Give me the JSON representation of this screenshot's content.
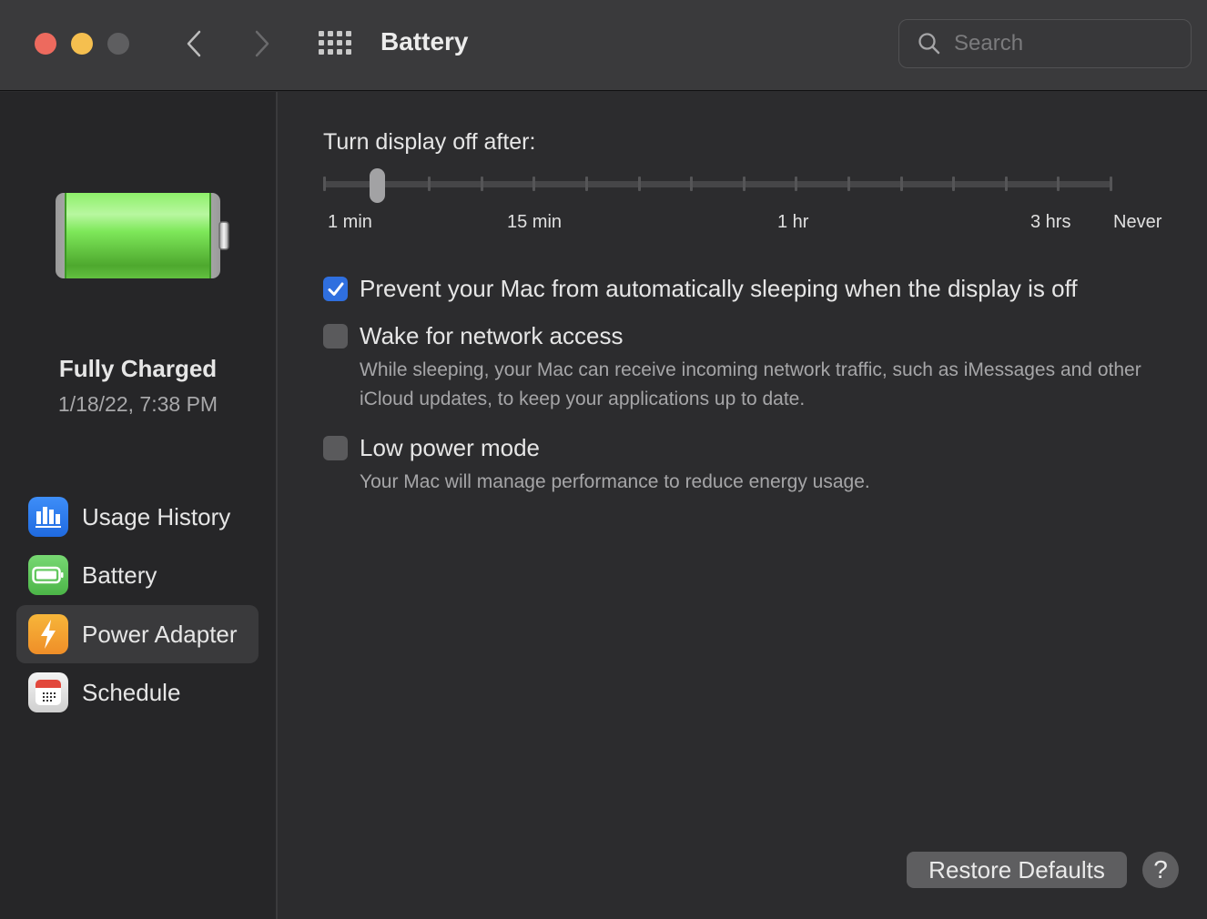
{
  "window": {
    "title": "Battery",
    "search_placeholder": "Search",
    "search_value": ""
  },
  "sidebar": {
    "status_title": "Fully Charged",
    "status_date": "1/18/22, 7:38 PM",
    "battery_level_percent": 100,
    "items": [
      {
        "label": "Usage History",
        "icon": "bar-chart-icon",
        "active": false
      },
      {
        "label": "Battery",
        "icon": "battery-icon",
        "active": false
      },
      {
        "label": "Power Adapter",
        "icon": "lightning-bolt-icon",
        "active": true
      },
      {
        "label": "Schedule",
        "icon": "calendar-icon",
        "active": false
      }
    ]
  },
  "main": {
    "slider": {
      "label": "Turn display off after:",
      "tick_count": 16,
      "selected_index": 1,
      "selected_value": "2 min",
      "tick_labels": [
        "1 min",
        "15 min",
        "1 hr",
        "3 hrs",
        "Never"
      ]
    },
    "options": [
      {
        "label": "Prevent your Mac from automatically sleeping when the display is off",
        "checked": true,
        "description": ""
      },
      {
        "label": "Wake for network access",
        "checked": false,
        "description": "While sleeping, your Mac can receive incoming network traffic, such as iMessages and other iCloud updates, to keep your applications up to date."
      },
      {
        "label": "Low power mode",
        "checked": false,
        "description": "Your Mac will manage performance to reduce energy usage."
      }
    ],
    "restore_label": "Restore Defaults",
    "help_label": "?"
  },
  "colors": {
    "accent": "#2f6fdf",
    "battery_green": "#6fe04f",
    "close": "#ed6a5e",
    "minimize": "#f5bf4f"
  }
}
